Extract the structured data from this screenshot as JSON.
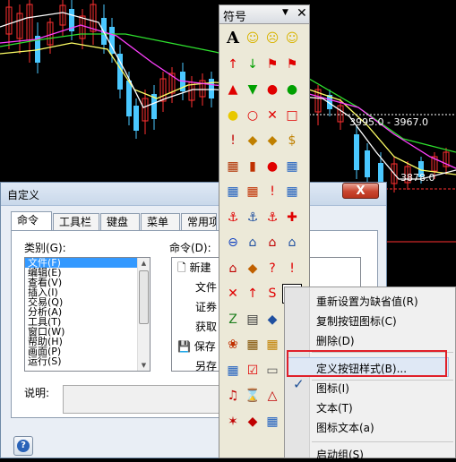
{
  "chart": {
    "price_label": "3995.0 - 3967.0",
    "price_label2": "3878.0"
  },
  "dialog": {
    "title": "自定义",
    "close_label": "X",
    "tabs": [
      "命令",
      "工具栏",
      "键盘",
      "菜单",
      "常用项"
    ],
    "categories_label": "类别(G):",
    "commands_label": "命令(D):",
    "categories": [
      "文件(F)",
      "编辑(E)",
      "查看(V)",
      "插入(I)",
      "交易(Q)",
      "分析(A)",
      "工具(T)",
      "窗口(W)",
      "帮助(H)",
      "画面(P)",
      "运行(S)"
    ],
    "commands": [
      "新建",
      "文件",
      "证券",
      "获取",
      "保存",
      "另存"
    ],
    "desc_label": "说明:",
    "help_icon": "question-icon"
  },
  "palette": {
    "title": "符号",
    "dropdown_glyph": "▼",
    "close_glyph": "✕"
  },
  "menu": {
    "items": [
      "重新设置为缺省值(R)",
      "复制按钮图标(C)",
      "删除(D)",
      "定义按钮样式(B)...",
      "图标(I)",
      "文本(T)",
      "图标文本(a)",
      "启动组(S)"
    ],
    "checked_item": "图标(I)",
    "highlighted_item": "定义按钮样式(B)..."
  }
}
